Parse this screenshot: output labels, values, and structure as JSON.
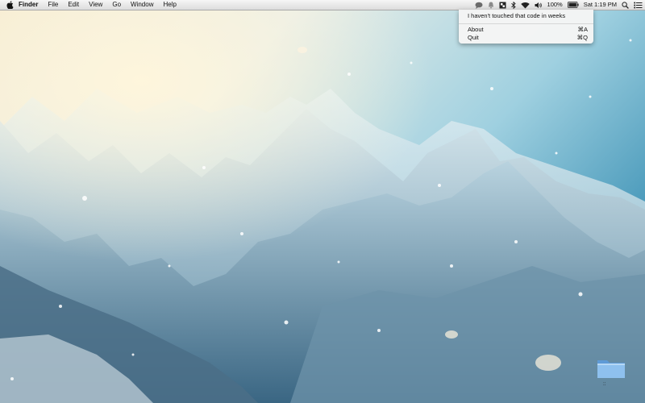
{
  "menubar": {
    "icons": {
      "apple": "apple-logo-icon"
    },
    "app_name": "Finder",
    "menus": [
      "File",
      "Edit",
      "View",
      "Go",
      "Window",
      "Help"
    ],
    "status": {
      "icons": [
        "speech-bubble-icon",
        "notification-bell-icon",
        "app-status-icon",
        "bluetooth-icon",
        "wifi-icon",
        "volume-icon",
        "battery-icon",
        "search-icon",
        "list-icon"
      ],
      "battery_percent": "100%",
      "clock": "Sat 1:19 PM"
    }
  },
  "dropdown": {
    "header": "I haven't touched that code in weeks",
    "items": [
      {
        "label": "About",
        "shortcut": "⌘A"
      },
      {
        "label": "Quit",
        "shortcut": "⌘Q"
      }
    ]
  },
  "desktop": {
    "wallpaper": "snowy mountains",
    "folder_icon": "folder-icon",
    "folder_caption": "::"
  },
  "colors": {
    "menubar": "#e8e8e8",
    "highlight": "#3a66d5",
    "folder": "#7fb4e6"
  }
}
